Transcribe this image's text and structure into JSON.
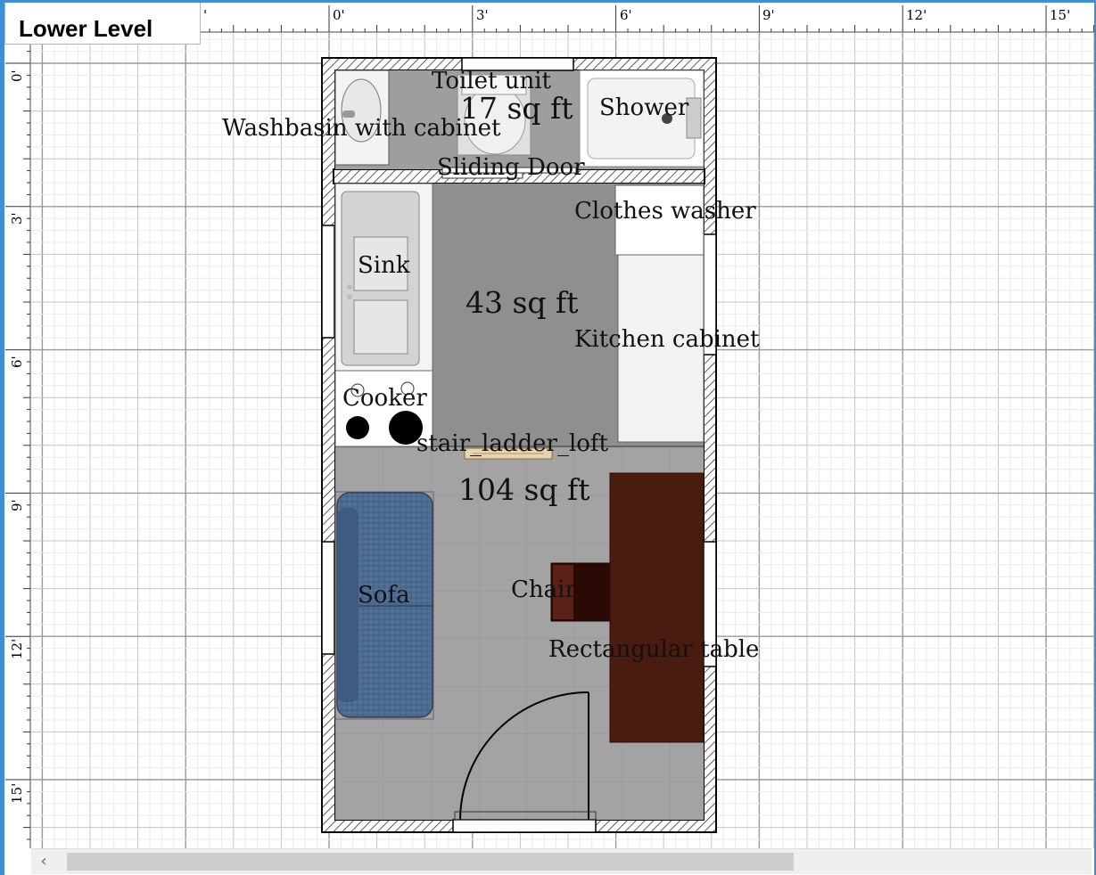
{
  "level_tab": {
    "label": "Lower Level"
  },
  "ruler": {
    "horizontal_ticks": [
      "'",
      "0'",
      "3'",
      "6'",
      "9'",
      "12'",
      "15'"
    ],
    "vertical_ticks": [
      "0'",
      "3'",
      "6'",
      "9'",
      "12'",
      "15'"
    ]
  },
  "rooms": {
    "bathroom_area": "17 sq ft",
    "kitchen_area": "43 sq ft",
    "living_area": "104 sq ft"
  },
  "furniture": {
    "toilet": "Toilet unit",
    "washbasin": "Washbasin with cabinet",
    "shower": "Shower",
    "sliding_door": "Sliding Door",
    "clothes_washer": "Clothes washer",
    "sink": "Sink",
    "kitchen_cabinet": "Kitchen cabinet",
    "cooker": "Cooker",
    "stair": "stair_ladder_loft",
    "sofa": "Sofa",
    "chair": "Chair",
    "table": "Rectangular table"
  },
  "colors": {
    "frame_accent": "#3f8fd8",
    "floor_gray": "#9e9e9e",
    "table_brown": "#4a1c10",
    "sofa_blue": "#4a6488"
  }
}
